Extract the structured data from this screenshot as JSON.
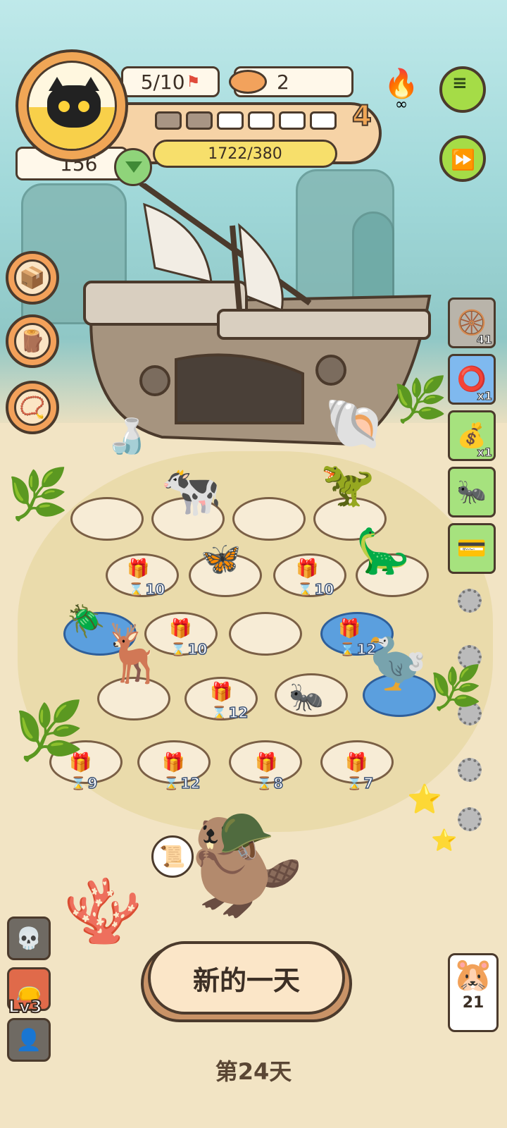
{
  "player": {
    "stage_progress": "5/10",
    "cans_count": "2",
    "exp_text": "1722/380",
    "level": "4",
    "gems": "156",
    "segments_filled": 2,
    "segments_total": 6
  },
  "side_items": [
    {
      "name": "wheel-item",
      "count": "41",
      "icon": "🛞",
      "bg": "#b9b4aa"
    },
    {
      "name": "collar-item",
      "count": "x1",
      "icon": "⭕",
      "bg": "#7fb9ef"
    },
    {
      "name": "bag-item",
      "count": "x1",
      "icon": "💰",
      "bg": "#a6e27e"
    },
    {
      "name": "ant-card",
      "count": "",
      "icon": "🐜",
      "bg": "#a6e27e"
    },
    {
      "name": "card-item",
      "count": "",
      "icon": "💳",
      "bg": "#a6e27e"
    }
  ],
  "plots": [
    {
      "timer": "10"
    },
    {
      "timer": "10"
    },
    {
      "timer": "10"
    },
    {
      "timer": "12"
    },
    {
      "timer": "12"
    },
    {
      "timer": "9"
    },
    {
      "timer": "12"
    },
    {
      "timer": "8"
    },
    {
      "timer": "7"
    }
  ],
  "new_day_label": "新的一天",
  "day_label": "第24天",
  "level_badge": "Lv3",
  "pet_counter": "21",
  "colors": {
    "accent": "#f0a656",
    "green": "#a5dc47",
    "outline": "#4b3a2c"
  }
}
